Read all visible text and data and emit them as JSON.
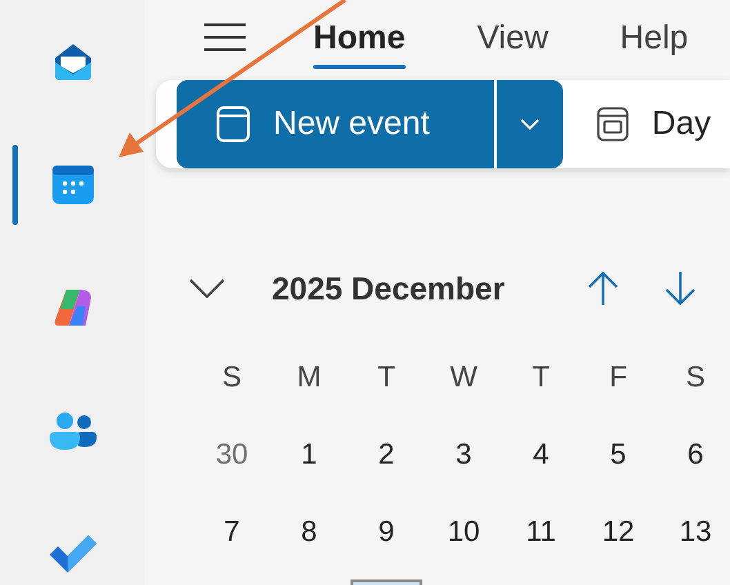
{
  "rail": {
    "items": [
      {
        "kind": "mail",
        "selected": false
      },
      {
        "kind": "calendar",
        "selected": true
      },
      {
        "kind": "copilot",
        "selected": false
      },
      {
        "kind": "people",
        "selected": false
      },
      {
        "kind": "todo",
        "selected": false
      }
    ]
  },
  "menu": {
    "tabs": [
      {
        "label": "Home",
        "selected": true
      },
      {
        "label": "View",
        "selected": false
      },
      {
        "label": "Help",
        "selected": false
      }
    ]
  },
  "toolbar": {
    "new_event": "New event",
    "view_button": "Day"
  },
  "mini_calendar": {
    "title": "2025 December",
    "weekdays": [
      {
        "label": "S",
        "today_column": false
      },
      {
        "label": "M",
        "today_column": false
      },
      {
        "label": "T",
        "today_column": true
      },
      {
        "label": "W",
        "today_column": false
      },
      {
        "label": "T",
        "today_column": false
      },
      {
        "label": "F",
        "today_column": false
      },
      {
        "label": "S",
        "today_column": false
      }
    ],
    "weeks": [
      [
        {
          "day": "30",
          "outside_month": true
        },
        {
          "day": "1",
          "outside_month": false
        },
        {
          "day": "2",
          "outside_month": false
        },
        {
          "day": "3",
          "outside_month": false
        },
        {
          "day": "4",
          "outside_month": false
        },
        {
          "day": "5",
          "outside_month": false
        },
        {
          "day": "6",
          "outside_month": false
        }
      ],
      [
        {
          "day": "7",
          "outside_month": false
        },
        {
          "day": "8",
          "outside_month": false
        },
        {
          "day": "9",
          "outside_month": false
        },
        {
          "day": "10",
          "outside_month": false
        },
        {
          "day": "11",
          "outside_month": false
        },
        {
          "day": "12",
          "outside_month": false
        },
        {
          "day": "13",
          "outside_month": false
        }
      ]
    ]
  },
  "annotation_arrow": true
}
